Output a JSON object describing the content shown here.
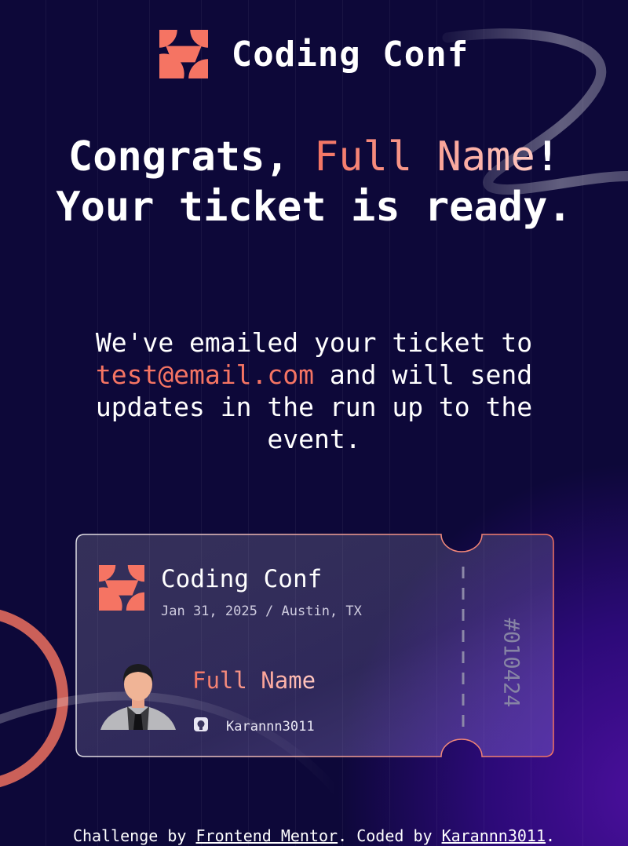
{
  "header": {
    "logo_icon": "coding-conf-logo",
    "app_title": "Coding Conf"
  },
  "hero": {
    "title_prefix": "Congrats, ",
    "title_name": "Full Name",
    "title_exclaim": "!",
    "title_line2": "Your ticket is ready.",
    "subtitle_prefix": "We've emailed your ticket to ",
    "email": "test@email.com",
    "subtitle_suffix": " and will send updates in the run up to the event."
  },
  "ticket": {
    "title": "Coding Conf",
    "date_location": "Jan 31, 2025 / Austin, TX",
    "attendee_name": "Full Name",
    "github_icon": "github-icon",
    "github_username": "Karannn3011",
    "ticket_number": "#010424"
  },
  "footer": {
    "challenge_prefix": "Challenge by ",
    "challenge_link": "Frontend Mentor",
    "coded_prefix": ". Coded by ",
    "coded_link": "Karannn3011",
    "suffix": "."
  },
  "colors": {
    "background": "#0d0839",
    "accent_orange": "#f57463",
    "name_gradient_end": "#ffc8c1",
    "ticket_border": "#f37362",
    "muted_text": "#8784a5"
  }
}
